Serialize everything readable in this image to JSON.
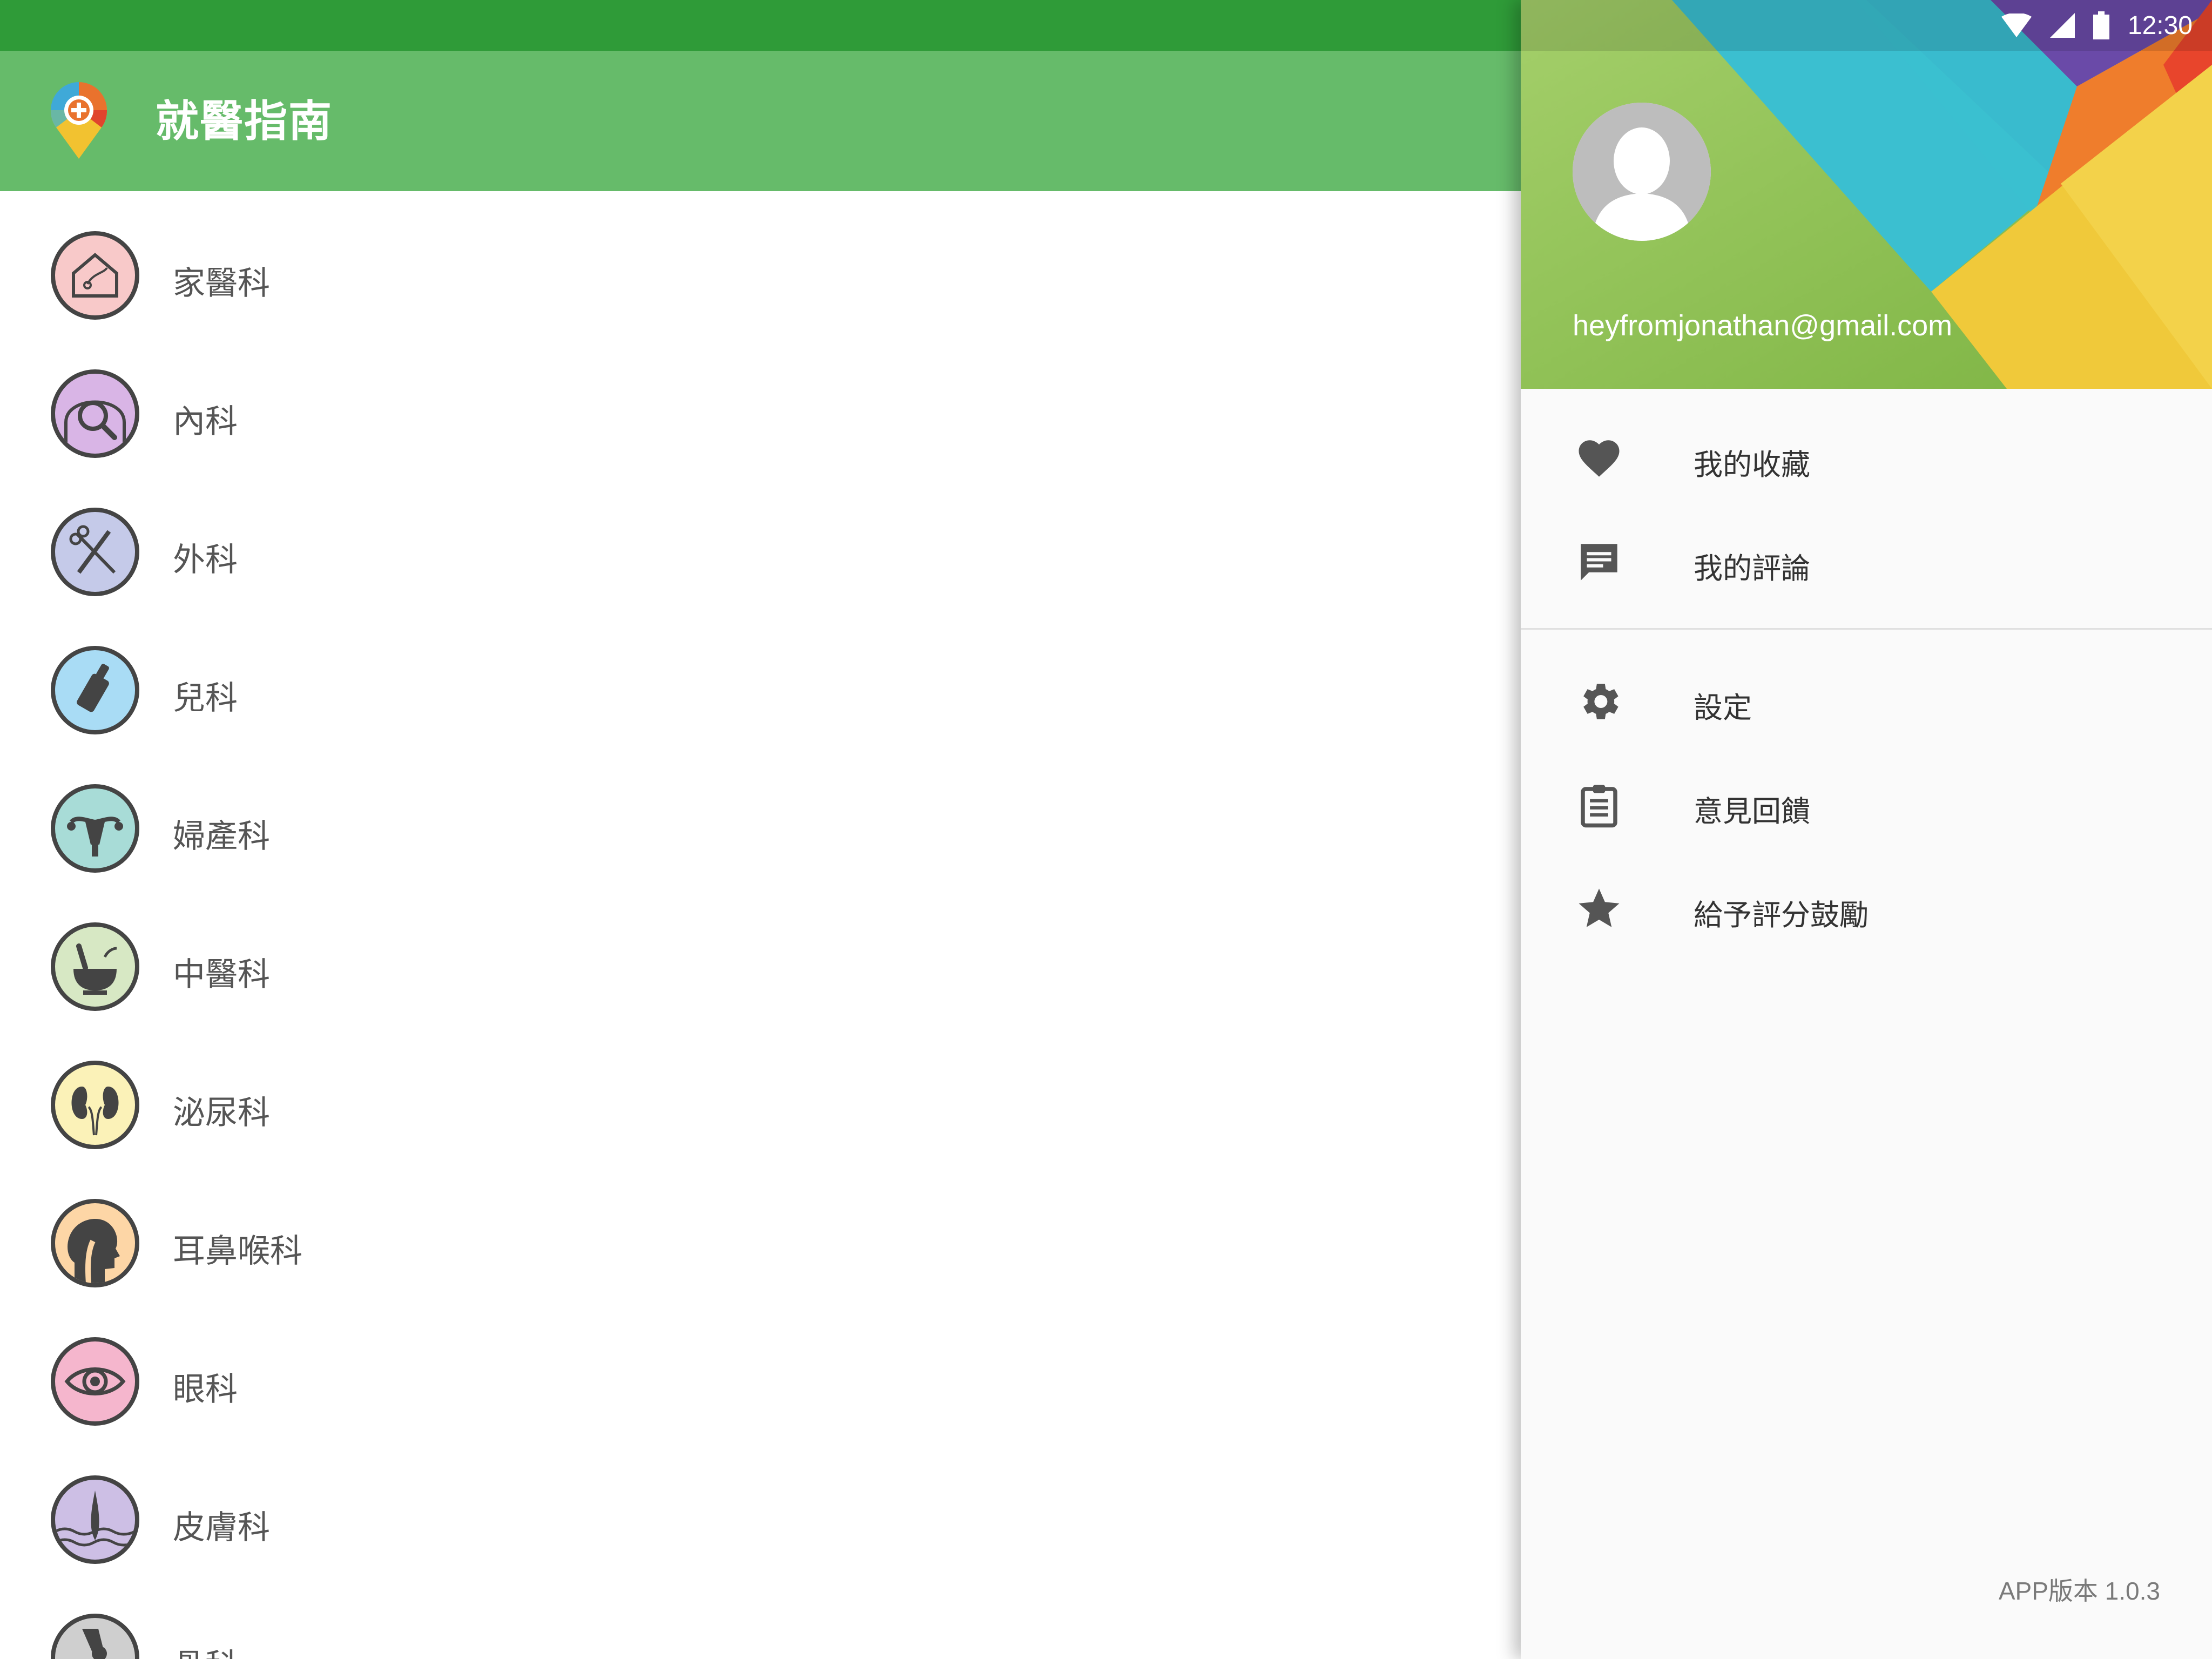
{
  "app": {
    "title": "就醫指南"
  },
  "status_bar": {
    "time": "12:30"
  },
  "categories": [
    {
      "label": "家醫科",
      "icon": "house-stethoscope-icon",
      "color": "#f8c9c9"
    },
    {
      "label": "內科",
      "icon": "magnifier-body-icon",
      "color": "#d9b5e6"
    },
    {
      "label": "外科",
      "icon": "scissors-scalpel-icon",
      "color": "#c5cae9"
    },
    {
      "label": "兒科",
      "icon": "baby-bottle-icon",
      "color": "#a9dcf5"
    },
    {
      "label": "婦產科",
      "icon": "uterus-icon",
      "color": "#a8dcd7"
    },
    {
      "label": "中醫科",
      "icon": "mortar-herb-icon",
      "color": "#d7e8c4"
    },
    {
      "label": "泌尿科",
      "icon": "kidneys-icon",
      "color": "#fbf2b8"
    },
    {
      "label": "耳鼻喉科",
      "icon": "head-throat-icon",
      "color": "#fdd6a6"
    },
    {
      "label": "眼科",
      "icon": "eye-icon",
      "color": "#f5b6cd"
    },
    {
      "label": "皮膚科",
      "icon": "hair-skin-icon",
      "color": "#cdbfe5"
    },
    {
      "label": "骨科",
      "icon": "bone-joint-icon",
      "color": "#cfcfcf"
    }
  ],
  "drawer": {
    "account_email": "heyfromjonathan@gmail.com",
    "menu_primary": [
      {
        "label": "我的收藏",
        "icon": "heart-icon"
      },
      {
        "label": "我的評論",
        "icon": "comment-icon"
      }
    ],
    "menu_secondary": [
      {
        "label": "設定",
        "icon": "gear-icon"
      },
      {
        "label": "意見回饋",
        "icon": "clipboard-icon"
      },
      {
        "label": "給予評分鼓勵",
        "icon": "star-icon"
      }
    ],
    "version": "APP版本 1.0.3"
  },
  "colors": {
    "status_bar": "#2f9b38",
    "app_bar": "#66bb6a",
    "icon_outline": "#444444",
    "menu_icon": "#555555"
  }
}
